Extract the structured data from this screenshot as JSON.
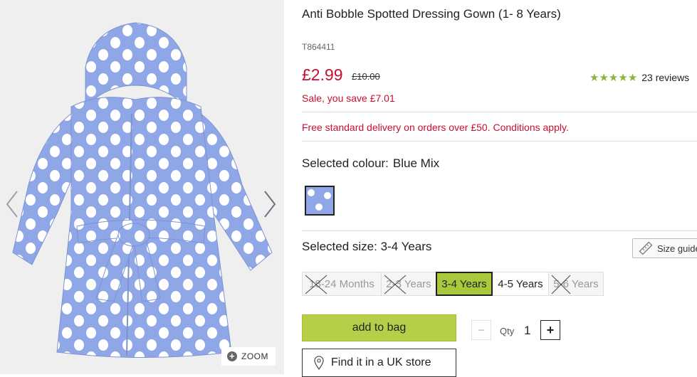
{
  "product": {
    "title": "Anti Bobble Spotted Dressing Gown (1- 8 Years)",
    "code": "T864411",
    "price": "£2.99",
    "was_price": "£10.00",
    "rating_value": 4.6,
    "reviews": "23 reviews",
    "sale_text": "Sale, you save £7.01",
    "delivery_text": "Free standard delivery on orders over £50. Conditions apply."
  },
  "gallery": {
    "zoom_label": "ZOOM",
    "icons": {
      "prev": "chevron-left-icon",
      "next": "chevron-right-icon",
      "zoom": "plus-circle-icon"
    }
  },
  "colour": {
    "label": "Selected colour:",
    "value": "Blue Mix",
    "swatch_color": "#8fa7e6"
  },
  "size": {
    "label": "Selected size:",
    "value": "3-4 Years",
    "guide_label": "Size guide",
    "options": [
      {
        "label": "18-24 Months",
        "available": false,
        "selected": false
      },
      {
        "label": "2-3 Years",
        "available": false,
        "selected": false
      },
      {
        "label": "3-4 Years",
        "available": true,
        "selected": true
      },
      {
        "label": "4-5 Years",
        "available": true,
        "selected": false
      },
      {
        "label": "5-6 Years",
        "available": false,
        "selected": false
      }
    ]
  },
  "actions": {
    "add_to_bag": "add to bag",
    "qty_label": "Qty",
    "qty_value": "1",
    "minus": "−",
    "plus": "+",
    "find_store": "Find it in a UK store"
  },
  "colors": {
    "accent_green": "#b5cf49",
    "sale_red": "#c8102e",
    "robe_blue": "#8fa7e6"
  }
}
